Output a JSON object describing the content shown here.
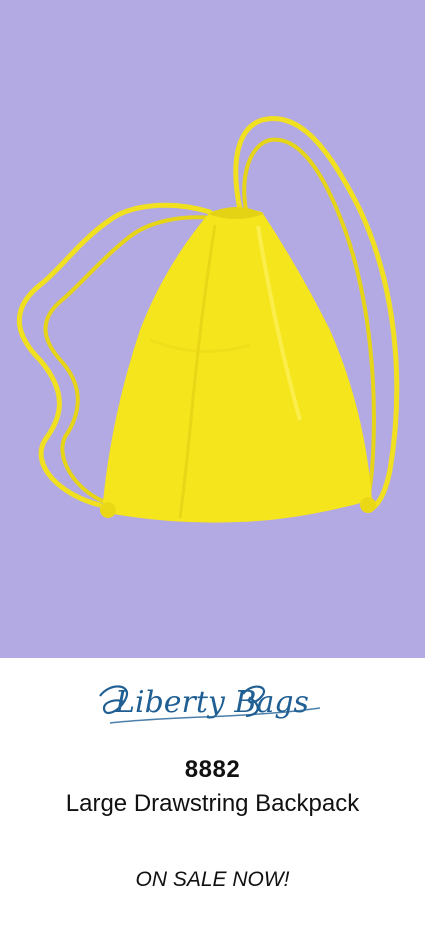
{
  "product": {
    "sku": "8882",
    "name": "Large Drawstring Backpack",
    "promo": "ON SALE NOW!"
  },
  "brand": {
    "logo_text": "Liberty Bags",
    "logo_color": "#1f5f93"
  },
  "photo": {
    "background_color": "#b3a9e3",
    "bag_color": "#f5e51c",
    "cord_color": "#f0e020",
    "icon": "drawstring-bag-photo"
  }
}
